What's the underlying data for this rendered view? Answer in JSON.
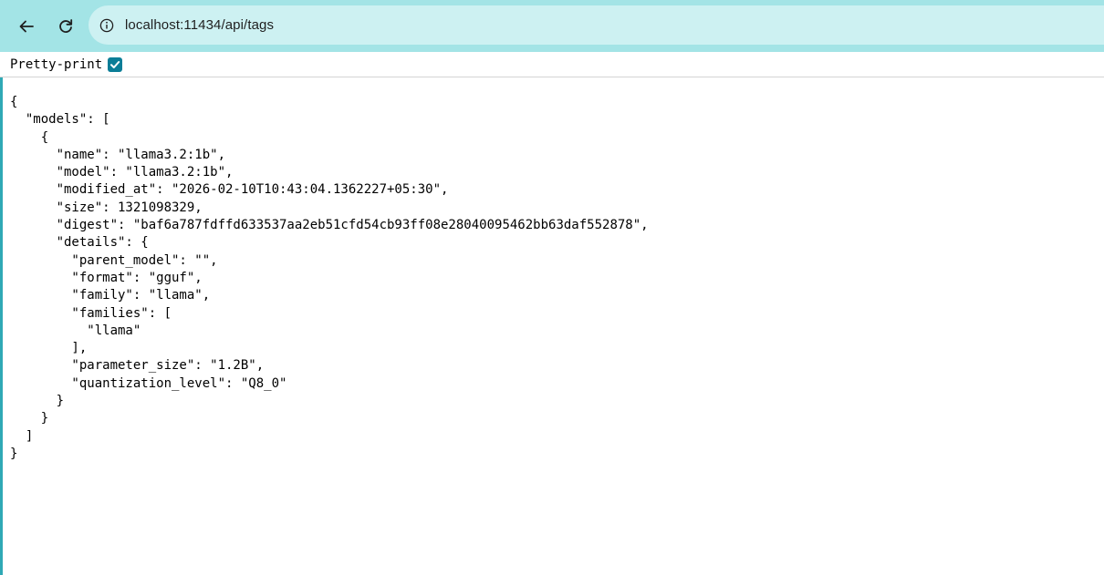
{
  "browser": {
    "url": "localhost:11434/api/tags",
    "back_icon": "arrow-left-icon",
    "reload_icon": "reload-icon",
    "site_info_icon": "info-circle-icon"
  },
  "pretty_print": {
    "label": "Pretty-print",
    "checked": true
  },
  "json_lines": [
    "{",
    "  \"models\": [",
    "    {",
    "      \"name\": \"llama3.2:1b\",",
    "      \"model\": \"llama3.2:1b\",",
    "      \"modified_at\": \"2026-02-10T10:43:04.1362227+05:30\",",
    "      \"size\": 1321098329,",
    "      \"digest\": \"baf6a787fdffd633537aa2eb51cfd54cb93ff08e28040095462bb63daf552878\",",
    "      \"details\": {",
    "        \"parent_model\": \"\",",
    "        \"format\": \"gguf\",",
    "        \"family\": \"llama\",",
    "        \"families\": [",
    "          \"llama\"",
    "        ],",
    "        \"parameter_size\": \"1.2B\",",
    "        \"quantization_level\": \"Q8_0\"",
    "      }",
    "    }",
    "  ]",
    "}"
  ],
  "colors": {
    "toolbar_bg": "#a3e4e6",
    "address_bar_bg": "#cdf1f2",
    "checkbox_accent": "#0b7d97",
    "left_strip": "#2fa9b5"
  }
}
